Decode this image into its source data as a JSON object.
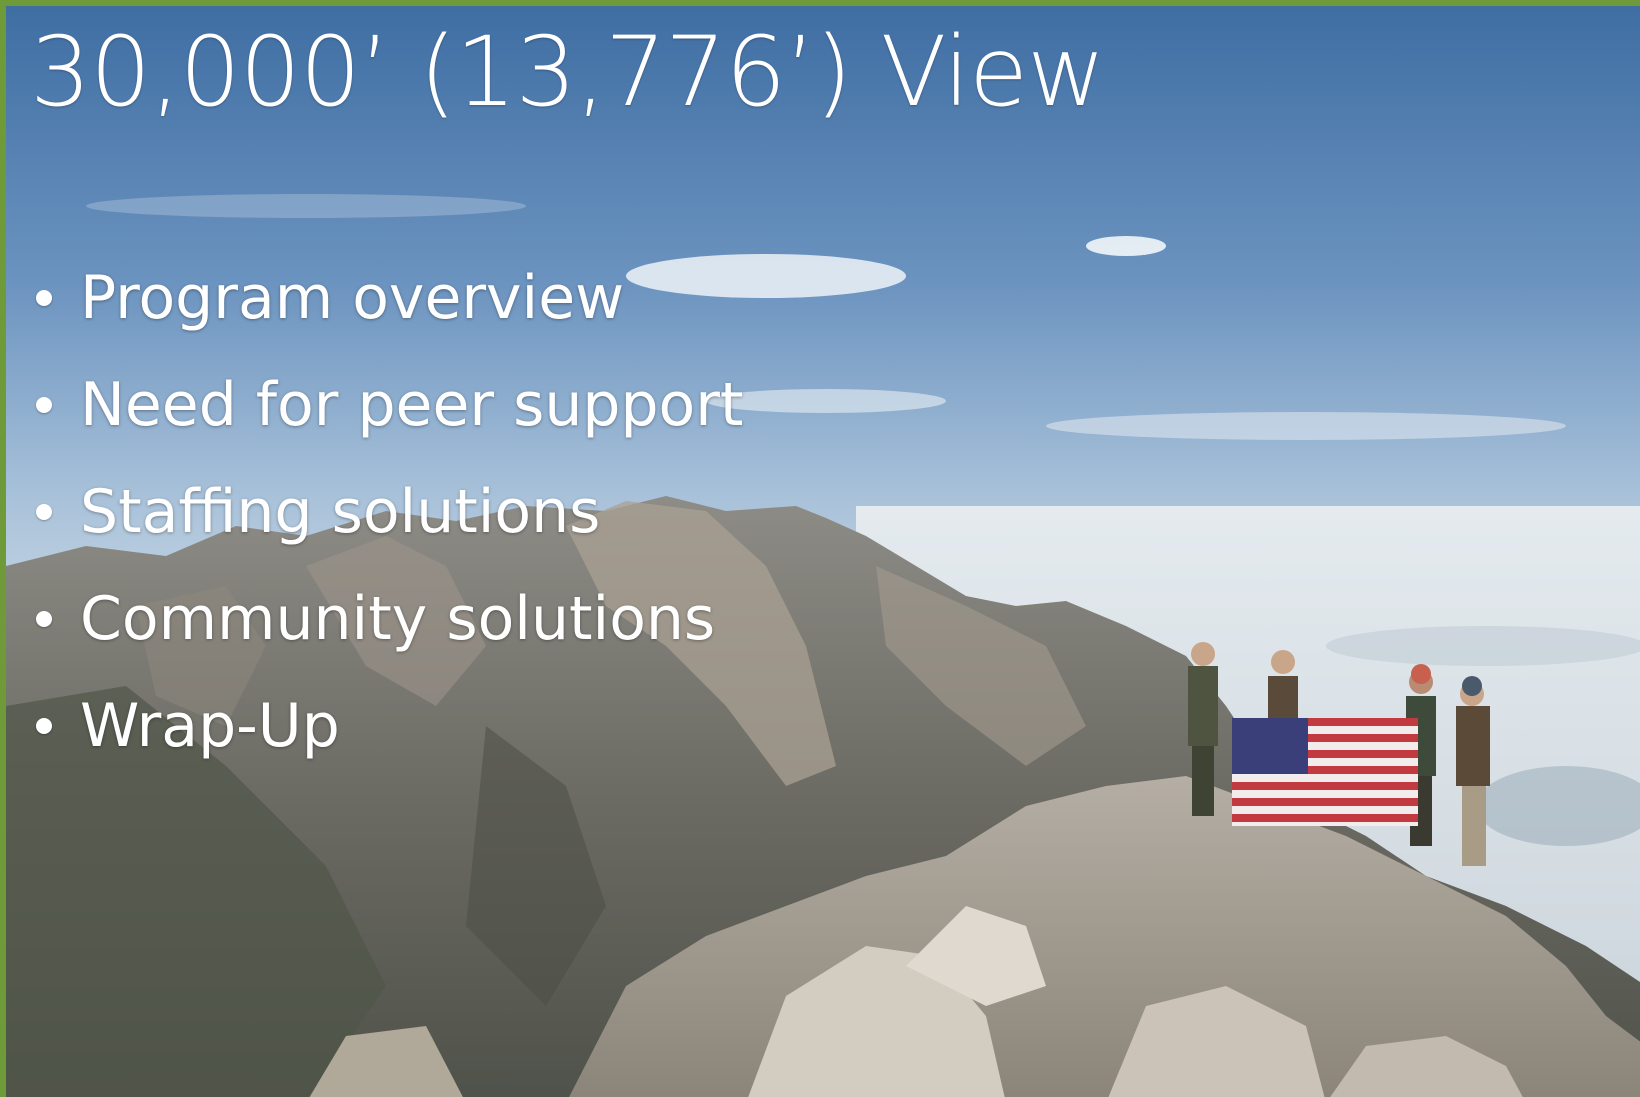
{
  "slide": {
    "title": "30,000’ (13,776’) View",
    "bullets": [
      "Program overview",
      "Need for peer support",
      "Staffing solutions",
      "Community solutions",
      "Wrap-Up"
    ]
  },
  "colors": {
    "border": "#6f9a3a",
    "text": "#ffffff"
  },
  "background_image": {
    "subject": "mountain-summit-team-with-us-flag"
  }
}
